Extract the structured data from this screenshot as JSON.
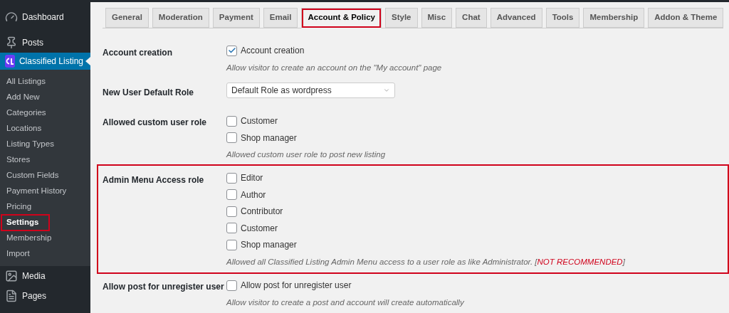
{
  "sidebar": {
    "items": [
      {
        "label": "Dashboard",
        "selected": false
      },
      {
        "label": "Posts",
        "selected": false
      },
      {
        "label": "Classified Listing",
        "selected": true,
        "children": [
          {
            "label": "All Listings",
            "selected": false,
            "highlighted": false
          },
          {
            "label": "Add New",
            "selected": false,
            "highlighted": false
          },
          {
            "label": "Categories",
            "selected": false,
            "highlighted": false
          },
          {
            "label": "Locations",
            "selected": false,
            "highlighted": false
          },
          {
            "label": "Listing Types",
            "selected": false,
            "highlighted": false
          },
          {
            "label": "Stores",
            "selected": false,
            "highlighted": false
          },
          {
            "label": "Custom Fields",
            "selected": false,
            "highlighted": false
          },
          {
            "label": "Payment History",
            "selected": false,
            "highlighted": false
          },
          {
            "label": "Pricing",
            "selected": false,
            "highlighted": false
          },
          {
            "label": "Settings",
            "selected": true,
            "highlighted": true
          },
          {
            "label": "Membership",
            "selected": false,
            "highlighted": false
          },
          {
            "label": "Import",
            "selected": false,
            "highlighted": false
          }
        ]
      },
      {
        "label": "Media",
        "selected": false
      },
      {
        "label": "Pages",
        "selected": false
      }
    ]
  },
  "tabs": [
    {
      "label": "General",
      "selected": false,
      "highlighted": false
    },
    {
      "label": "Moderation",
      "selected": false,
      "highlighted": false
    },
    {
      "label": "Payment",
      "selected": false,
      "highlighted": false
    },
    {
      "label": "Email",
      "selected": false,
      "highlighted": false
    },
    {
      "label": "Account & Policy",
      "selected": true,
      "highlighted": true
    },
    {
      "label": "Style",
      "selected": false,
      "highlighted": false
    },
    {
      "label": "Misc",
      "selected": false,
      "highlighted": false
    },
    {
      "label": "Chat",
      "selected": false,
      "highlighted": false
    },
    {
      "label": "Advanced",
      "selected": false,
      "highlighted": false
    },
    {
      "label": "Tools",
      "selected": false,
      "highlighted": false
    },
    {
      "label": "Membership",
      "selected": false,
      "highlighted": false
    },
    {
      "label": "Addon & Theme",
      "selected": false,
      "highlighted": false
    }
  ],
  "settings": [
    {
      "label": "Account creation",
      "kind": "checkboxes",
      "highlighted": false,
      "options": [
        {
          "label": "Account creation",
          "checked": true
        }
      ],
      "description": [
        {
          "text": "Allow visitor to create an account on the \"My account\" page",
          "kind": "plain"
        }
      ]
    },
    {
      "label": "New User Default Role",
      "kind": "select",
      "highlighted": false,
      "value": "Default Role as wordpress"
    },
    {
      "label": "Allowed custom user role",
      "kind": "checkboxes",
      "highlighted": false,
      "options": [
        {
          "label": "Customer",
          "checked": false
        },
        {
          "label": "Shop manager",
          "checked": false
        }
      ],
      "description": [
        {
          "text": "Allowed custom user role to post new listing",
          "kind": "plain"
        }
      ]
    },
    {
      "label": "Admin Menu Access role",
      "kind": "checkboxes",
      "highlighted": true,
      "options": [
        {
          "label": "Editor",
          "checked": false
        },
        {
          "label": "Author",
          "checked": false
        },
        {
          "label": "Contributor",
          "checked": false
        },
        {
          "label": "Customer",
          "checked": false
        },
        {
          "label": "Shop manager",
          "checked": false
        }
      ],
      "description": [
        {
          "text": "Allowed all Classified Listing Admin Menu access to a user role as like Administrator. [",
          "kind": "plain"
        },
        {
          "text": "NOT RECOMMENDED",
          "kind": "warning"
        },
        {
          "text": "]",
          "kind": "plain"
        }
      ]
    },
    {
      "label": "Allow post for unregister user",
      "kind": "checkboxes",
      "highlighted": false,
      "options": [
        {
          "label": "Allow post for unregister user",
          "checked": false
        }
      ],
      "description": [
        {
          "text": "Allow visitor to create a post and account will create automatically",
          "kind": "plain"
        }
      ]
    }
  ]
}
